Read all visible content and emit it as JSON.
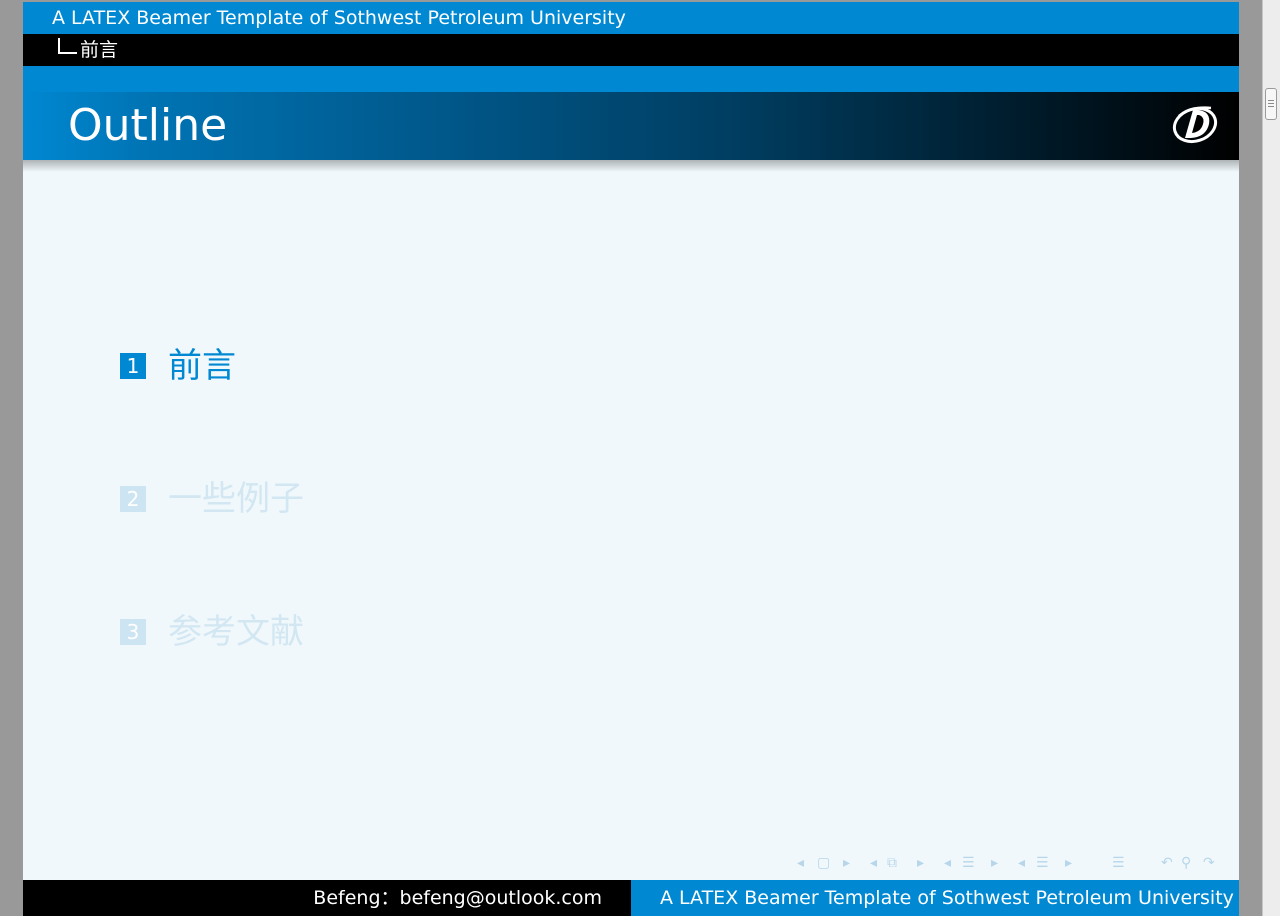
{
  "header": {
    "short_title": "A LATEX Beamer Template of Sothwest Petroleum University",
    "current_section": "前言"
  },
  "frame": {
    "title": "Outline",
    "logo_icon": "university-logo-icon"
  },
  "outline": {
    "items": [
      {
        "number": "1",
        "label": "前言",
        "state": "active"
      },
      {
        "number": "2",
        "label": "一些例子",
        "state": "inactive"
      },
      {
        "number": "3",
        "label": "参考文献",
        "state": "inactive"
      }
    ]
  },
  "navigation": {
    "icons": [
      "nav-slide-prev-icon",
      "nav-slide-icon",
      "nav-slide-next-icon",
      "nav-frame-prev-icon",
      "nav-frame-icon",
      "nav-frame-next-icon",
      "nav-subsection-prev-icon",
      "nav-subsection-icon",
      "nav-subsection-next-icon",
      "nav-section-prev-icon",
      "nav-section-icon",
      "nav-section-next-icon",
      "nav-document-icon",
      "nav-back-icon",
      "nav-search-icon",
      "nav-forward-icon"
    ]
  },
  "footer": {
    "author_info": "Befeng：befeng@outlook.com",
    "short_title": "A LATEX Beamer Template of Sothwest Petroleum University"
  },
  "colors": {
    "primary": "#0088d2",
    "dark": "#000000",
    "background": "#f0f8fc",
    "inactive_text": "#d2e7f2"
  }
}
